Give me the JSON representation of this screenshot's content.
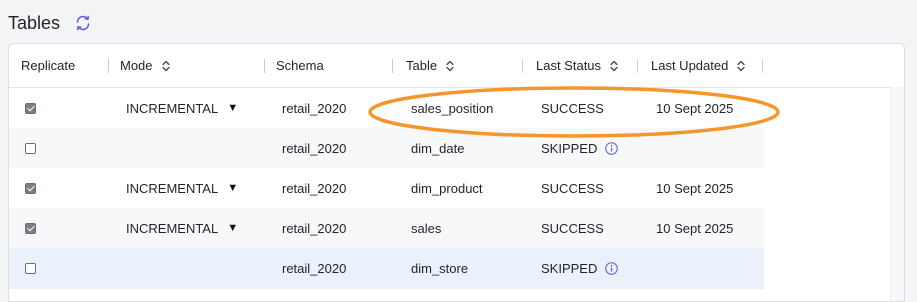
{
  "header": {
    "title": "Tables",
    "refresh_icon": "refresh-icon"
  },
  "table": {
    "columns": [
      {
        "label": "Replicate",
        "sortable": false
      },
      {
        "label": "Mode",
        "sortable": true
      },
      {
        "label": "Schema",
        "sortable": false
      },
      {
        "label": "Table",
        "sortable": true
      },
      {
        "label": "Last Status",
        "sortable": true
      },
      {
        "label": "Last Updated",
        "sortable": true
      }
    ],
    "rows": [
      {
        "replicate": true,
        "mode": "INCREMENTAL",
        "schema": "retail_2020",
        "table": "sales_position",
        "status": "SUCCESS",
        "info": false,
        "updated": "10 Sept 2025"
      },
      {
        "replicate": false,
        "mode": "",
        "schema": "retail_2020",
        "table": "dim_date",
        "status": "SKIPPED",
        "info": true,
        "updated": ""
      },
      {
        "replicate": true,
        "mode": "INCREMENTAL",
        "schema": "retail_2020",
        "table": "dim_product",
        "status": "SUCCESS",
        "info": false,
        "updated": "10 Sept 2025"
      },
      {
        "replicate": true,
        "mode": "INCREMENTAL",
        "schema": "retail_2020",
        "table": "sales",
        "status": "SUCCESS",
        "info": false,
        "updated": "10 Sept 2025"
      },
      {
        "replicate": false,
        "mode": "",
        "schema": "retail_2020",
        "table": "dim_store",
        "status": "SKIPPED",
        "info": true,
        "updated": ""
      }
    ]
  },
  "colors": {
    "annotation": "#f5962a",
    "accent": "#5b5bd6",
    "selected_row": "#eaf1fb"
  }
}
